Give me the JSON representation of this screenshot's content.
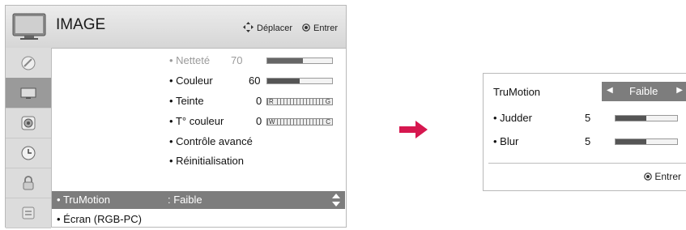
{
  "menu": {
    "title": "IMAGE",
    "nav_move": "Déplacer",
    "nav_enter": "Entrer",
    "items": [
      {
        "label": "Netteté",
        "value": "70",
        "level": 0.55,
        "dim": true
      },
      {
        "label": "Couleur",
        "value": "60",
        "level": 0.5
      },
      {
        "label": "Teinte",
        "value": "0",
        "left": "R",
        "right": "G"
      },
      {
        "label": "T° couleur",
        "value": "0",
        "left": "W",
        "right": "C"
      },
      {
        "label": "Contrôle avancé"
      },
      {
        "label": "Réinitialisation"
      }
    ],
    "selected": {
      "label": "TruMotion",
      "value": ": Faible"
    },
    "next_item": "Écran (RGB-PC)"
  },
  "sidebar": {
    "icons": [
      "satellite-dish-icon",
      "monitor-icon",
      "speaker-icon",
      "clock-icon",
      "lock-icon",
      "options-icon"
    ],
    "active_index": 1
  },
  "popup": {
    "title": "TruMotion",
    "value": "Faible",
    "judder": {
      "label": "Judder",
      "value": "5",
      "level": 0.5
    },
    "blur": {
      "label": "Blur",
      "value": "5",
      "level": 0.5
    },
    "enter": "Entrer"
  },
  "colors": {
    "arrow": "#d6174f",
    "highlight": "#7d7d7d"
  }
}
